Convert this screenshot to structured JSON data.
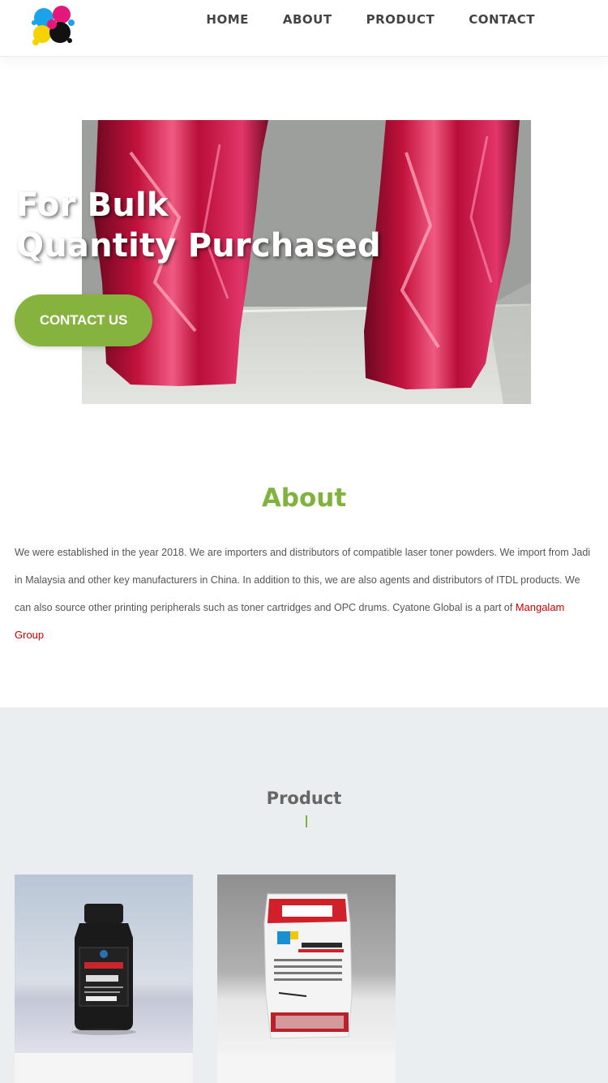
{
  "header": {
    "logo_icon": "ink-splash-logo",
    "nav": [
      "HOME",
      "ABOUT",
      "PRODUCT",
      "CONTACT"
    ]
  },
  "hero": {
    "title_line1": "For Bulk",
    "title_line2": "Quantity Purchased",
    "button_label": "CONTACT US",
    "image": "red-foil-toner-bags-photo"
  },
  "about": {
    "title": "About",
    "text": "We were established in the year 2018. We are importers and distributors of compatible laser toner powders. We import from Jadi in Malaysia and other key manufacturers in China. In addition to this, we are also agents and distributors of ITDL products. We can also source other printing peripherals such as toner cartridges and OPC drums. Cyatone Global is a part of ",
    "link": "Mangalam Group"
  },
  "product": {
    "title": "Product",
    "items": [
      {
        "image": "supremo-toner-bottle-photo"
      },
      {
        "image": "cyatone-toner-bag-photo"
      }
    ]
  },
  "colors": {
    "accent_green": "#80b33b",
    "link_red": "#cc0000",
    "section_bg": "#ebeef1"
  }
}
